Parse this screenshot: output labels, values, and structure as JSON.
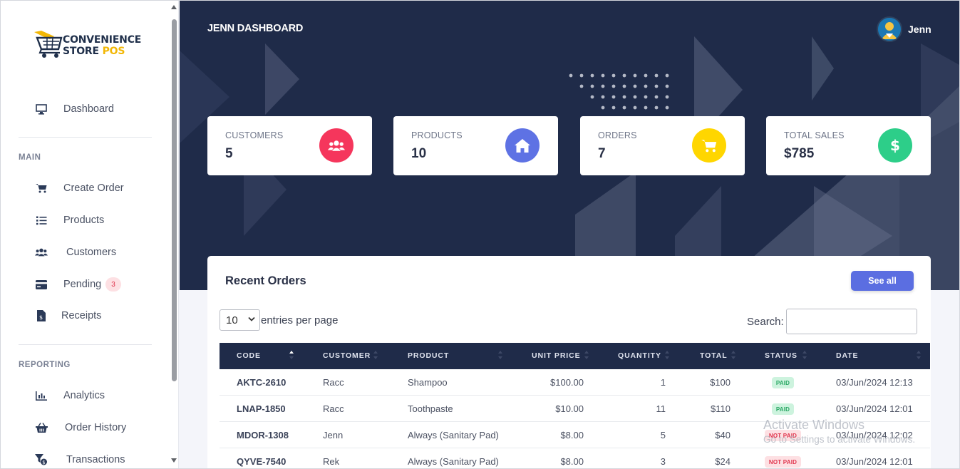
{
  "sidebar": {
    "logo": {
      "line1": "CONVENIENCE",
      "line2a": "STORE ",
      "line2b": "POS"
    },
    "dashboard": {
      "label": "Dashboard",
      "icon": "monitor-icon"
    },
    "section_main": "MAIN",
    "main_items": [
      {
        "label": "Create Order",
        "icon": "cart-icon"
      },
      {
        "label": "Products",
        "icon": "list-icon"
      },
      {
        "label": "Customers",
        "icon": "users-icon"
      },
      {
        "label": "Pending",
        "icon": "card-icon",
        "badge": "3"
      },
      {
        "label": "Receipts",
        "icon": "receipt-icon"
      }
    ],
    "section_reporting": "REPORTING",
    "reporting_items": [
      {
        "label": "Analytics",
        "icon": "bar-chart-icon"
      },
      {
        "label": "Order History",
        "icon": "basket-icon"
      },
      {
        "label": "Transactions",
        "icon": "filter-dollar-icon"
      }
    ]
  },
  "header": {
    "title": "JENN DASHBOARD",
    "user_name": "Jenn"
  },
  "stats": [
    {
      "label": "CUSTOMERS",
      "value": "5",
      "color": "#f5365c",
      "icon": "users-icon"
    },
    {
      "label": "PRODUCTS",
      "value": "10",
      "color": "#5e72e4",
      "icon": "home-icon"
    },
    {
      "label": "ORDERS",
      "value": "7",
      "color": "#ffd600",
      "icon": "cart-icon"
    },
    {
      "label": "TOTAL SALES",
      "value": "$785",
      "color": "#2dce89",
      "icon": "dollar-icon"
    }
  ],
  "orders": {
    "title": "Recent Orders",
    "see_all": "See all",
    "per_page_value": "10",
    "per_page_label": "entries per page",
    "search_label": "Search:",
    "columns": [
      "CODE",
      "CUSTOMER",
      "PRODUCT",
      "UNIT PRICE",
      "QUANTITY",
      "TOTAL",
      "STATUS",
      "DATE"
    ],
    "rows": [
      {
        "code": "AKTC-2610",
        "customer": "Racc",
        "product": "Shampoo",
        "unit_price": "$100.00",
        "quantity": "1",
        "total": "$100",
        "status": "PAID",
        "date": "03/Jun/2024 12:13"
      },
      {
        "code": "LNAP-1850",
        "customer": "Racc",
        "product": "Toothpaste",
        "unit_price": "$10.00",
        "quantity": "11",
        "total": "$110",
        "status": "PAID",
        "date": "03/Jun/2024 12:01"
      },
      {
        "code": "MDOR-1308",
        "customer": "Jenn",
        "product": "Always (Sanitary Pad)",
        "unit_price": "$8.00",
        "quantity": "5",
        "total": "$40",
        "status": "NOT PAID",
        "date": "03/Jun/2024 12:02"
      },
      {
        "code": "QYVE-7540",
        "customer": "Rek",
        "product": "Always (Sanitary Pad)",
        "unit_price": "$8.00",
        "quantity": "3",
        "total": "$24",
        "status": "NOT PAID",
        "date": "03/Jun/2024 12:01"
      }
    ]
  },
  "watermark": {
    "line1": "Activate Windows",
    "line2": "Go to Settings to activate Windows."
  }
}
